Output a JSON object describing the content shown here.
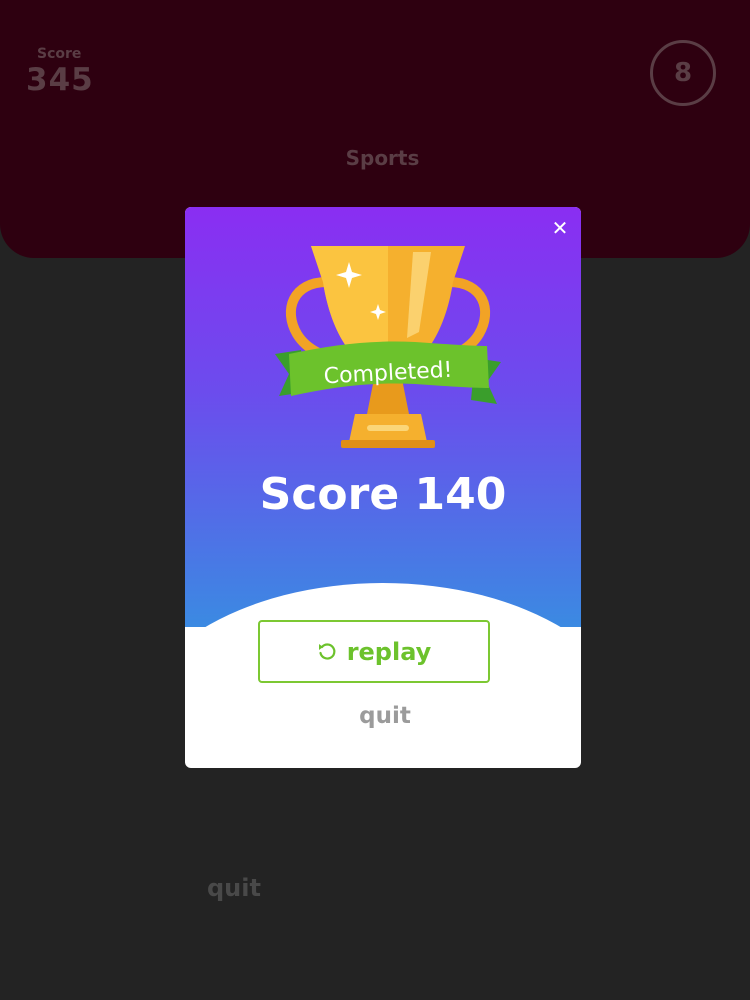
{
  "header": {
    "score_label": "Score",
    "score_value": "345",
    "level": "8",
    "category": "Sports"
  },
  "background": {
    "quit_label": "quit"
  },
  "modal": {
    "close_symbol": "✕",
    "ribbon_text": "Completed!",
    "final_score": "Score 140",
    "replay_label": "replay",
    "quit_label": "quit"
  },
  "icons": {
    "close": "close-icon",
    "trophy": "trophy-icon",
    "replay": "replay-icon"
  },
  "colors": {
    "background": "#232323",
    "header": "#2e0010",
    "modal_gradient_top": "#8a2ef2",
    "modal_gradient_bottom": "#3b8ae2",
    "accent_green": "#6cc22c",
    "trophy_gold": "#f5b02e",
    "quit_gray": "#9b9b9b"
  }
}
